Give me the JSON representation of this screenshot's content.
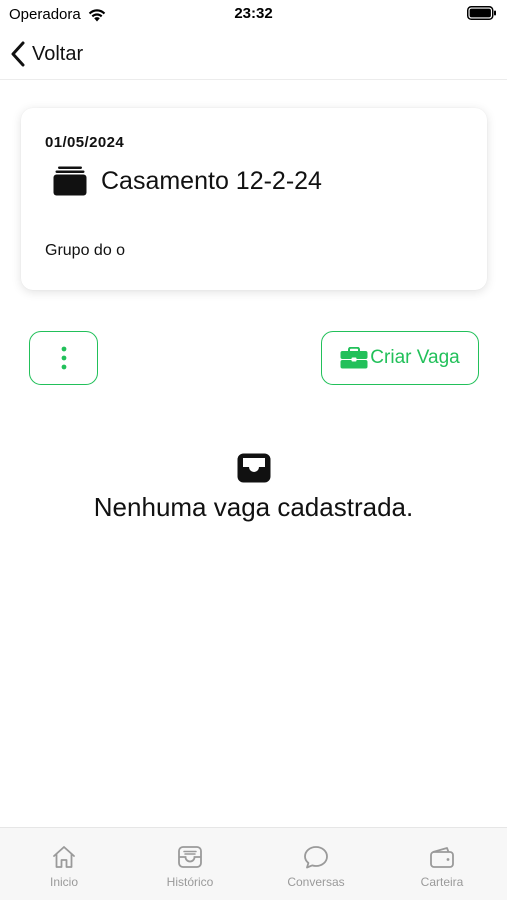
{
  "status_bar": {
    "carrier": "Operadora",
    "time": "23:32"
  },
  "nav": {
    "back_label": "Voltar"
  },
  "event": {
    "date": "01/05/2024",
    "title": "Casamento 12-2-24",
    "group": "Grupo do o"
  },
  "actions": {
    "create_label": "Criar Vaga",
    "accent_color": "#22c05a"
  },
  "empty_state": {
    "icon": "inbox-icon",
    "message": "Nenhuma vaga cadastrada."
  },
  "tabs": [
    {
      "label": "Inicio",
      "icon": "home-icon"
    },
    {
      "label": "Histórico",
      "icon": "history-inbox-icon"
    },
    {
      "label": "Conversas",
      "icon": "chat-bubble-icon"
    },
    {
      "label": "Carteira",
      "icon": "wallet-icon"
    }
  ]
}
